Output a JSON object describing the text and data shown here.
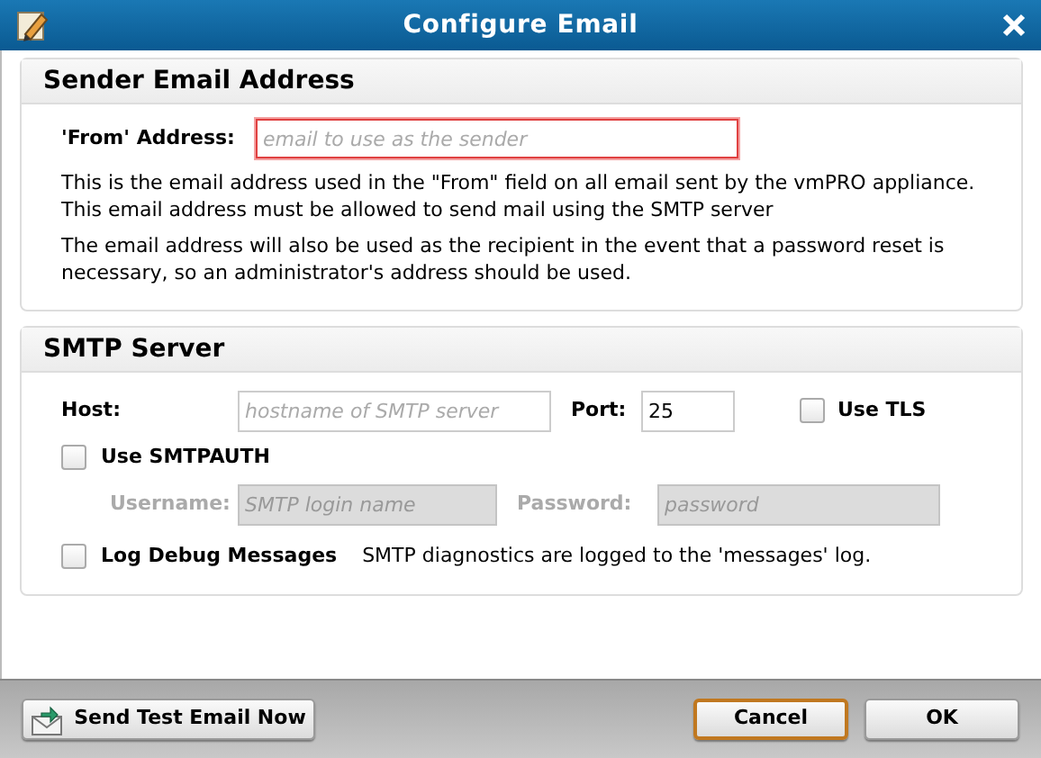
{
  "window": {
    "title": "Configure Email"
  },
  "sender": {
    "heading": "Sender Email Address",
    "from": {
      "label": "'From' Address:",
      "placeholder": "email to use as the sender",
      "invalid": true
    },
    "notes": [
      "This is the email address used in the \"From\" field on all email sent by the vmPRO appliance.  This email address must be allowed to send mail using the SMTP server",
      "The email address will also be used as the recipient in the event that a password reset is necessary, so an administrator's address should be used."
    ]
  },
  "smtp": {
    "heading": "SMTP Server",
    "host": {
      "label": "Host:",
      "placeholder": "hostname of SMTP server"
    },
    "port": {
      "label": "Port:",
      "value": "25"
    },
    "use_tls": {
      "label": "Use TLS",
      "checked": false
    },
    "smtpauth": {
      "label": "Use SMTPAUTH",
      "checked": false
    },
    "username": {
      "label": "Username:",
      "placeholder": "SMTP login name",
      "disabled": true
    },
    "password": {
      "label": "Password:",
      "placeholder": "password",
      "disabled": true
    },
    "log_debug": {
      "label": "Log Debug Messages",
      "checked": false
    },
    "log_note": "SMTP diagnostics are logged to the 'messages' log."
  },
  "buttons": [
    {
      "label": "Send Test Email Now",
      "kind": "send",
      "focused": false
    },
    {
      "label": "Cancel",
      "kind": "cancel",
      "focused": true
    },
    {
      "label": "OK",
      "kind": "ok",
      "focused": false
    }
  ]
}
